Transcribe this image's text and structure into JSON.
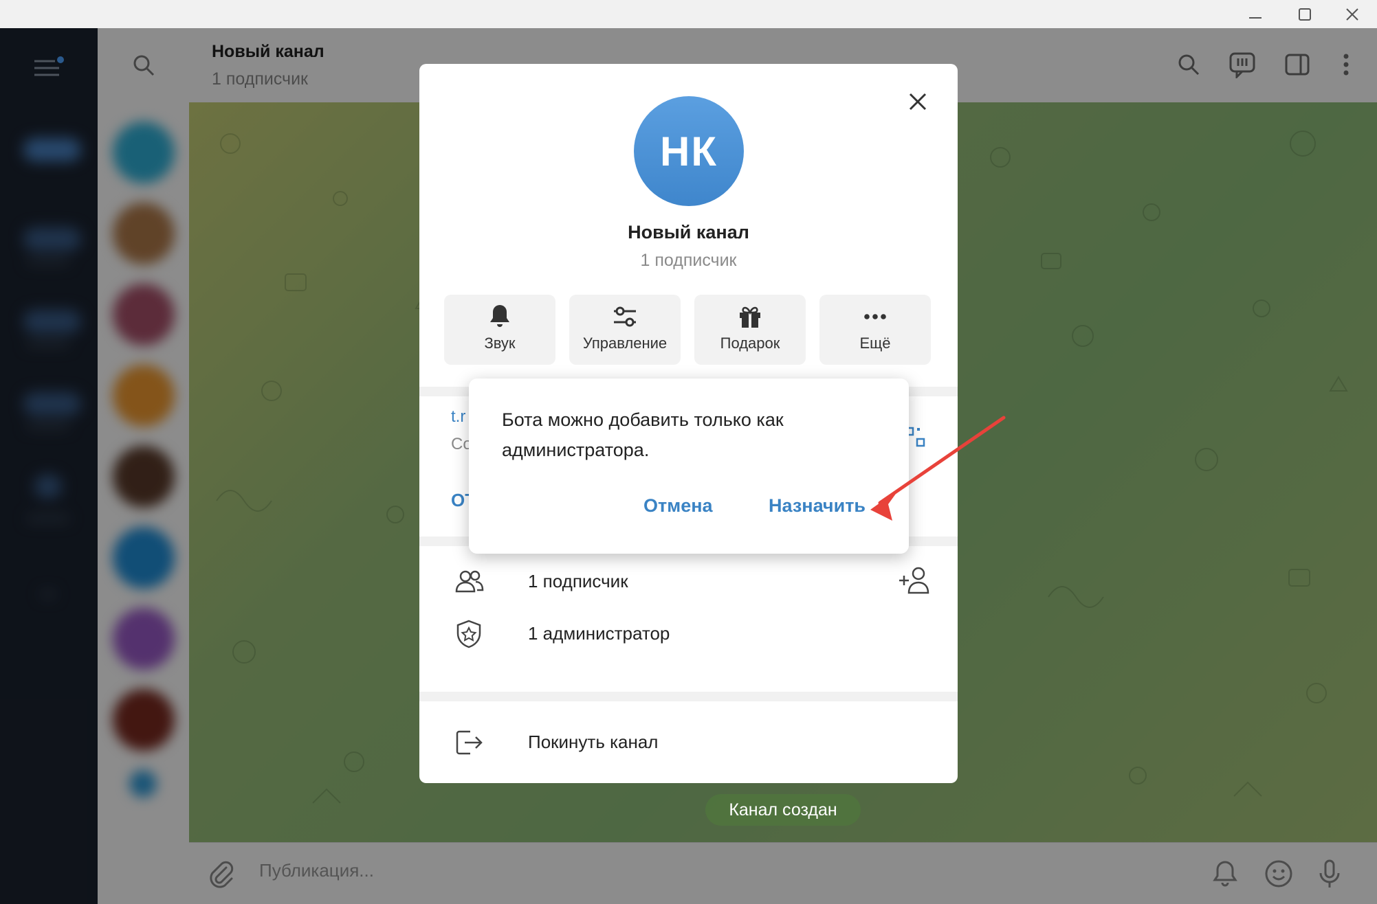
{
  "window": {
    "minimize_icon": "minimize-icon",
    "maximize_icon": "maximize-icon",
    "close_icon": "close-icon"
  },
  "header": {
    "title": "Новый канал",
    "subtitle": "1 подписчик",
    "icons": [
      "search-icon",
      "comments-icon",
      "sidebar-toggle-icon",
      "more-vertical-icon"
    ]
  },
  "panel": {
    "avatar_initials": "НК",
    "name": "Новый канал",
    "subtitle": "1 подписчик",
    "actions": [
      {
        "label": "Звук",
        "icon": "bell-icon"
      },
      {
        "label": "Управление",
        "icon": "sliders-icon"
      },
      {
        "label": "Подарок",
        "icon": "gift-icon"
      },
      {
        "label": "Ещё",
        "icon": "more-horizontal-icon"
      }
    ],
    "link_fragment": "t.r",
    "link_sub_fragment": "Co",
    "link_action_fragment": "OT",
    "rows": [
      {
        "label": "1 подписчик",
        "icon": "users-icon"
      },
      {
        "label": "1 администратор",
        "icon": "shield-star-icon"
      }
    ],
    "leave": {
      "label": "Покинуть канал",
      "icon": "leave-icon"
    }
  },
  "dialog": {
    "message": "Бота можно добавить только как администратора.",
    "cancel": "Отмена",
    "assign": "Назначить"
  },
  "chat": {
    "service_message": "Канал создан"
  },
  "composer": {
    "placeholder": "Публикация..."
  },
  "colors": {
    "accent": "#3a83c4",
    "avatar": "#4a90d6",
    "arrow": "#e8423a",
    "sidebar": "#1b2330"
  }
}
